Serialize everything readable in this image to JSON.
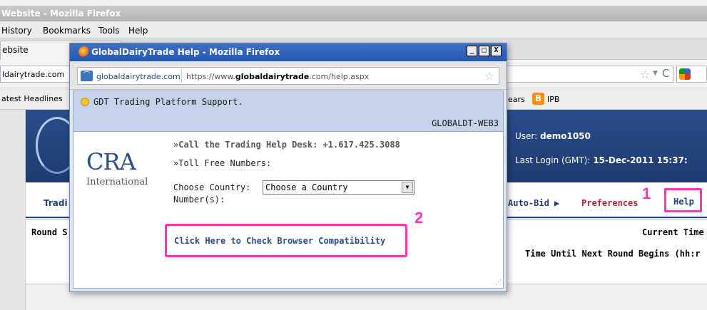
{
  "background_window": {
    "title": "Website - Mozilla Firefox",
    "menu": [
      "History",
      "Bookmarks",
      "Tools",
      "Help"
    ],
    "tab_label": "ebsite",
    "url_fragment": "ldairytrade.com",
    "bookmarks": {
      "left": "atest Headlines",
      "years": "ears",
      "ipb_icon": "B",
      "ipb": "IPB"
    }
  },
  "page": {
    "user_label": "User: ",
    "user_value": "demo1050",
    "last_login_label": "Last Login (GMT): ",
    "last_login_value": "15-Dec-2011 15:37:",
    "nav": {
      "trading": "Tradi",
      "auto_bid": "Auto-Bid ▶",
      "preferences": "Preferences",
      "help": "Help"
    },
    "table": {
      "round_label": "Round S",
      "current_time": "Current Time",
      "time_until": "Time Until Next Round Begins (hh:r"
    }
  },
  "annotations": {
    "marker_1": "1",
    "marker_2": "2",
    "highlight_color": "#ff33b5"
  },
  "popup": {
    "title": "GlobalDairyTrade Help - Mozilla Firefox",
    "controls": {
      "minimize": "_",
      "maximize": "□",
      "close": "X"
    },
    "site_identity": "globaldairytrade.com",
    "url_prefix": "https://www.",
    "url_domain": "globaldairytrade",
    "url_suffix": ".com/help.aspx",
    "support_text": "GDT Trading Platform Support.",
    "server": "GLOBALDT-WEB3",
    "logo_big": "CRA",
    "logo_small": "International",
    "call_line": "»Call the Trading Help Desk: +1.617.425.3088",
    "tollfree_line": "»Toll Free Numbers:",
    "country_label": "Choose Country:",
    "country_select_value": "Choose a Country",
    "numbers_label": "Number(s):",
    "compat_link": "Click Here to Check Browser Compatibility"
  },
  "icons": {
    "firefox": "firefox-icon",
    "star": "bookmark-star-icon",
    "reload": "reload-icon",
    "bulb": "lightbulb-icon",
    "dropdown": "chevron-down-icon"
  },
  "colors": {
    "header_blue": "#203f78",
    "popup_titlebar": "#2558b3",
    "link_blue": "#2a4c8b",
    "preferences_red": "#b22233"
  }
}
